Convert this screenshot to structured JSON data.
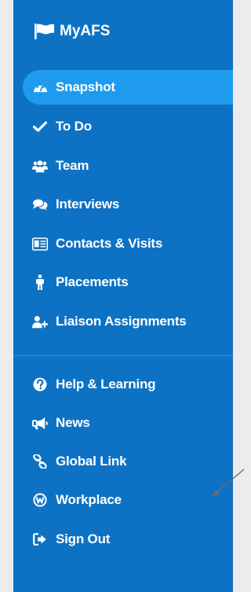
{
  "brand": {
    "title": "MyAFS",
    "icon": "flag-icon"
  },
  "nav": {
    "primary": [
      {
        "label": "Snapshot",
        "icon": "dashboard-icon",
        "active": true
      },
      {
        "label": "To Do",
        "icon": "check-icon"
      },
      {
        "label": "Team",
        "icon": "users-icon"
      },
      {
        "label": "Interviews",
        "icon": "chat-bubbles-icon"
      },
      {
        "label": "Contacts & Visits",
        "icon": "id-card-icon"
      },
      {
        "label": "Placements",
        "icon": "person-icon"
      },
      {
        "label": "Liaison Assignments",
        "icon": "user-plus-icon"
      }
    ],
    "secondary": [
      {
        "label": "Help & Learning",
        "icon": "question-icon"
      },
      {
        "label": "News",
        "icon": "bullhorn-icon"
      },
      {
        "label": "Global Link",
        "icon": "link-icon"
      },
      {
        "label": "Workplace",
        "icon": "workplace-icon"
      },
      {
        "label": "Sign Out",
        "icon": "sign-out-icon"
      }
    ]
  },
  "colors": {
    "sidebar_bg": "#0e72c4",
    "active_bg": "#1f9bed",
    "page_bg": "#ececec",
    "text": "#ffffff",
    "arrow": "#6b6b6b"
  }
}
